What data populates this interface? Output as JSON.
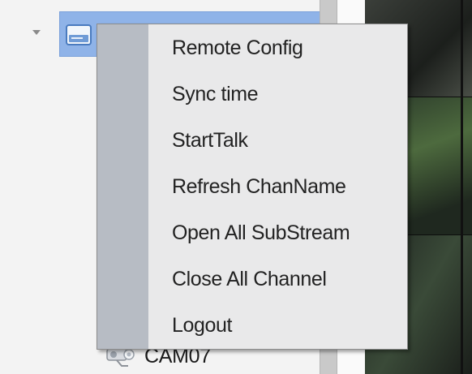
{
  "device_tree": {
    "camera_label": "CAM07"
  },
  "context_menu": {
    "items": [
      {
        "label": "Remote Config"
      },
      {
        "label": "Sync time"
      },
      {
        "label": "StartTalk"
      },
      {
        "label": "Refresh ChanName"
      },
      {
        "label": "Open All SubStream"
      },
      {
        "label": "Close All Channel"
      },
      {
        "label": "Logout"
      }
    ]
  },
  "icons": {
    "expander": "triangle-down-icon",
    "device": "hard-drive-icon",
    "camera": "camera-icon"
  },
  "colors": {
    "selection": "#8fb3e8",
    "menu_background": "#e9e9ea",
    "menu_gutter": "#b7bcc4",
    "menu_text": "#222222"
  }
}
